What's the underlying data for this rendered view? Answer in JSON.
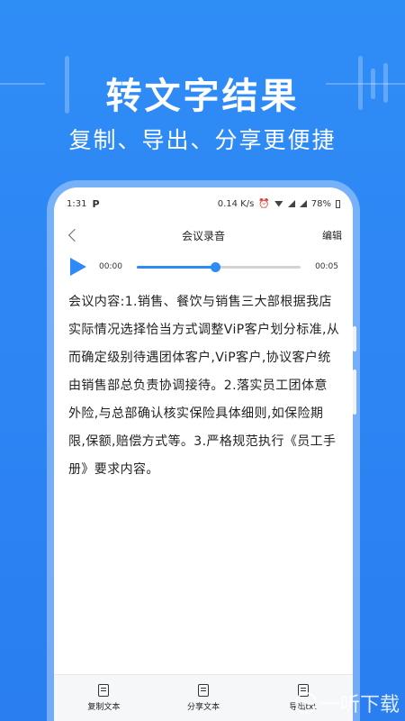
{
  "promo": {
    "headline": "转文字结果",
    "subline": "复制、导出、分享更便捷"
  },
  "statusbar": {
    "time": "1:31",
    "notif_icon": "P",
    "speed": "0.14 K/s",
    "battery": "78%"
  },
  "navbar": {
    "title": "会议录音",
    "edit_label": "编辑"
  },
  "player": {
    "current_time": "00:00",
    "total_time": "00:05",
    "progress": 0.48
  },
  "transcript": {
    "text": "会议内容:1.销售、餐饮与销售三大部根据我店实际情况选择恰当方式调整ViP客户划分标准,从而确定级别待遇团体客户,ViP客户,协议客户统由销售部总负责协调接待。2.落实员工团体意外险,与总部确认核实保险具体细则,如保险期限,保额,赔偿方式等。3.严格规范执行《员工手册》要求内容。"
  },
  "bottombar": {
    "items": [
      {
        "label": "复制文本",
        "icon": "copy-icon"
      },
      {
        "label": "分享文本",
        "icon": "share-icon"
      },
      {
        "label": "导出txt",
        "icon": "export-icon"
      }
    ]
  },
  "watermark": {
    "text": "一听下载"
  },
  "colors": {
    "background": "#2f8df6",
    "accent": "#2f8af5"
  }
}
